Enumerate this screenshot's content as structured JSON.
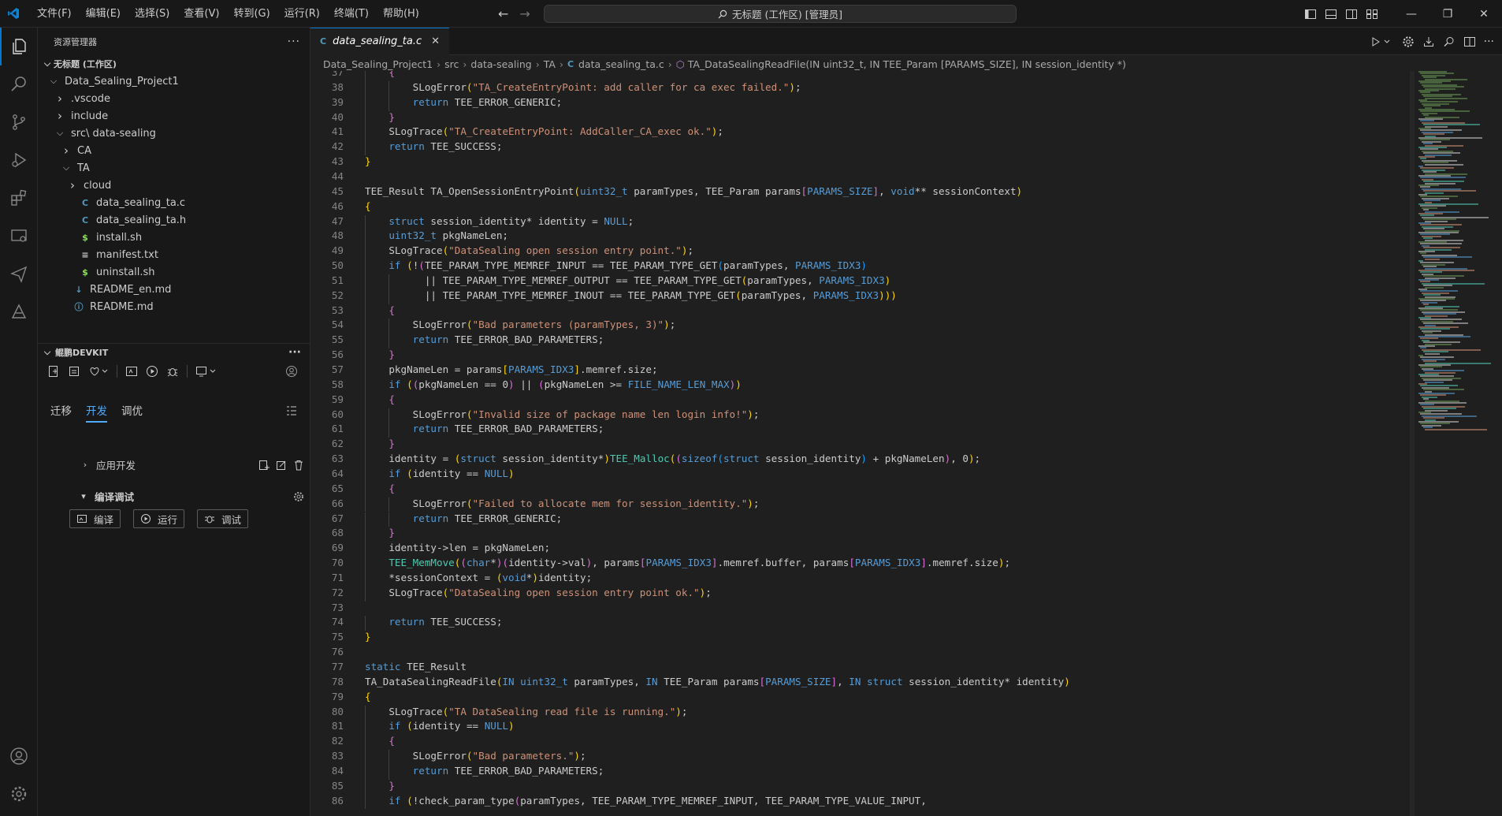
{
  "menu": [
    "文件(F)",
    "编辑(E)",
    "选择(S)",
    "查看(V)",
    "转到(G)",
    "运行(R)",
    "终端(T)",
    "帮助(H)"
  ],
  "search": {
    "text": "无标题 (工作区) [管理员]"
  },
  "explorer": {
    "title": "资源管理器",
    "workspace": "无标题 (工作区)",
    "items": [
      {
        "label": "Data_Sealing_Project1",
        "indent": 1,
        "chevron": "open",
        "icon": ""
      },
      {
        "label": ".vscode",
        "indent": 2,
        "chevron": "closed",
        "icon": ""
      },
      {
        "label": "include",
        "indent": 2,
        "chevron": "closed",
        "icon": ""
      },
      {
        "label": "src\\ data-sealing",
        "indent": 2,
        "chevron": "open",
        "icon": ""
      },
      {
        "label": "CA",
        "indent": 3,
        "chevron": "closed",
        "icon": ""
      },
      {
        "label": "TA",
        "indent": 3,
        "chevron": "open",
        "icon": ""
      },
      {
        "label": "cloud",
        "indent": 4,
        "chevron": "closed",
        "icon": ""
      },
      {
        "label": "data_sealing_ta.c",
        "indent": 4,
        "chevron": "",
        "icon": "C"
      },
      {
        "label": "data_sealing_ta.h",
        "indent": 4,
        "chevron": "",
        "icon": "C"
      },
      {
        "label": "install.sh",
        "indent": 4,
        "chevron": "",
        "icon": "$"
      },
      {
        "label": "manifest.txt",
        "indent": 4,
        "chevron": "",
        "icon": "≡"
      },
      {
        "label": "uninstall.sh",
        "indent": 4,
        "chevron": "",
        "icon": "$"
      },
      {
        "label": "README_en.md",
        "indent": 3,
        "chevron": "",
        "icon": "↓"
      },
      {
        "label": "README.md",
        "indent": 3,
        "chevron": "",
        "icon": "ⓘ"
      }
    ]
  },
  "devkit": {
    "title": "鲲鹏DEVKIT",
    "tabs": [
      "迁移",
      "开发",
      "调优"
    ],
    "active_tab": "开发",
    "app_dev": "应用开发",
    "build_debug": "编译调试",
    "buttons": [
      "编译",
      "运行",
      "调试"
    ]
  },
  "editor": {
    "tab": "data_sealing_ta.c",
    "tab_icon": "C",
    "breadcrumb": [
      "Data_Sealing_Project1",
      "src",
      "data-sealing",
      "TA",
      "data_sealing_ta.c",
      "TA_DataSealingReadFile(IN uint32_t, IN TEE_Param [PARAMS_SIZE], IN session_identity *)"
    ],
    "first_line": 37,
    "lines": [
      "    {",
      "        SLogError(\"TA_CreateEntryPoint: add caller for ca exec failed.\");",
      "        return TEE_ERROR_GENERIC;",
      "    }",
      "    SLogTrace(\"TA_CreateEntryPoint: AddCaller_CA_exec ok.\");",
      "    return TEE_SUCCESS;",
      "}",
      "",
      "TEE_Result TA_OpenSessionEntryPoint(uint32_t paramTypes, TEE_Param params[PARAMS_SIZE], void** sessionContext)",
      "{",
      "    struct session_identity* identity = NULL;",
      "    uint32_t pkgNameLen;",
      "    SLogTrace(\"DataSealing open session entry point.\");",
      "    if (!(TEE_PARAM_TYPE_MEMREF_INPUT == TEE_PARAM_TYPE_GET(paramTypes, PARAMS_IDX3)",
      "          || TEE_PARAM_TYPE_MEMREF_OUTPUT == TEE_PARAM_TYPE_GET(paramTypes, PARAMS_IDX3)",
      "          || TEE_PARAM_TYPE_MEMREF_INOUT == TEE_PARAM_TYPE_GET(paramTypes, PARAMS_IDX3)))",
      "    {",
      "        SLogError(\"Bad parameters (paramTypes, 3)\");",
      "        return TEE_ERROR_BAD_PARAMETERS;",
      "    }",
      "    pkgNameLen = params[PARAMS_IDX3].memref.size;",
      "    if ((pkgNameLen == 0) || (pkgNameLen >= FILE_NAME_LEN_MAX))",
      "    {",
      "        SLogError(\"Invalid size of package name len login info!\");",
      "        return TEE_ERROR_BAD_PARAMETERS;",
      "    }",
      "    identity = (struct session_identity*)TEE_Malloc((sizeof(struct session_identity) + pkgNameLen), 0);",
      "    if (identity == NULL)",
      "    {",
      "        SLogError(\"Failed to allocate mem for session_identity.\");",
      "        return TEE_ERROR_GENERIC;",
      "    }",
      "    identity->len = pkgNameLen;",
      "    TEE_MemMove((char*)(identity->val), params[PARAMS_IDX3].memref.buffer, params[PARAMS_IDX3].memref.size);",
      "    *sessionContext = (void*)identity;",
      "    SLogTrace(\"DataSealing open session entry point ok.\");",
      "",
      "    return TEE_SUCCESS;",
      "}",
      "",
      "static TEE_Result",
      "TA_DataSealingReadFile(IN uint32_t paramTypes, IN TEE_Param params[PARAMS_SIZE], IN struct session_identity* identity)",
      "{",
      "    SLogTrace(\"TA DataSealing read file is running.\");",
      "    if (identity == NULL)",
      "    {",
      "        SLogError(\"Bad parameters.\");",
      "        return TEE_ERROR_BAD_PARAMETERS;",
      "    }",
      "    if (!check_param_type(paramTypes, TEE_PARAM_TYPE_MEMREF_INPUT, TEE_PARAM_TYPE_VALUE_INPUT,"
    ]
  },
  "colors": {
    "keyword": "#569cd6",
    "string": "#ce9178",
    "function": "#dcdcaa",
    "type": "#4ec9b0",
    "macro": "#4fc1ff",
    "bracket1": "#ffd700",
    "bracket2": "#da70d6",
    "bracket3": "#179fff",
    "c_icon": "#519aba",
    "sh_icon": "#89e051",
    "accent": "#0078d4"
  }
}
